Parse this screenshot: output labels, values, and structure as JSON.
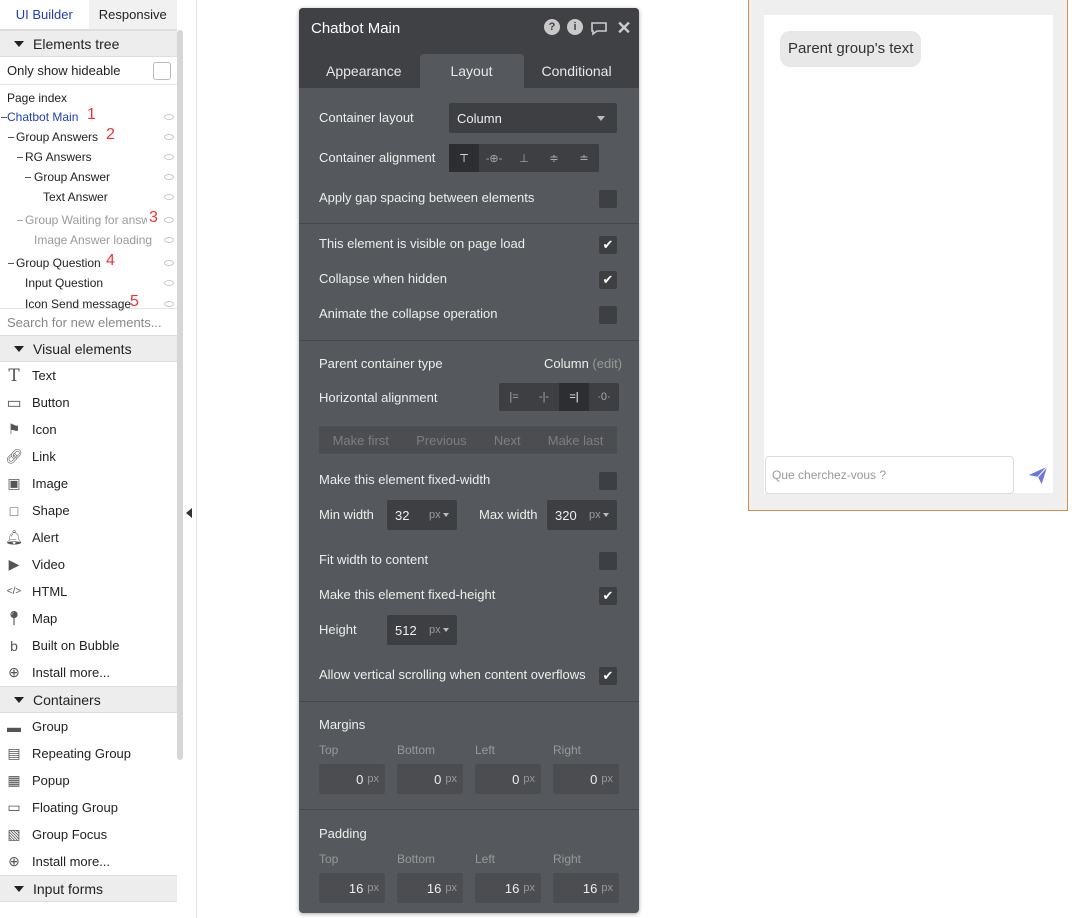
{
  "sidebar": {
    "tabs": [
      "UI Builder",
      "Responsive"
    ],
    "elements_tree_header": "Elements tree",
    "only_show_hideable": "Only show hideable",
    "page_index": "Page index",
    "tree": [
      {
        "label": "Chatbot Main",
        "num": "1"
      },
      {
        "label": "Group Answers",
        "num": "2"
      },
      {
        "label": "RG Answers"
      },
      {
        "label": "Group Answer"
      },
      {
        "label": "Text Answer"
      },
      {
        "label": "Group Waiting for answ",
        "num": "3"
      },
      {
        "label": "Image Answer loading"
      },
      {
        "label": "Group Question",
        "num": "4"
      },
      {
        "label": "Input Question"
      },
      {
        "label": "Icon Send message",
        "num": "5"
      }
    ],
    "search_placeholder": "Search for new elements...",
    "visual_header": "Visual elements",
    "visual_items": [
      {
        "label": "Text",
        "icon": "text-T-icon"
      },
      {
        "label": "Button",
        "icon": "button-click-icon"
      },
      {
        "label": "Icon",
        "icon": "flag-icon"
      },
      {
        "label": "Link",
        "icon": "link-icon"
      },
      {
        "label": "Image",
        "icon": "image-icon"
      },
      {
        "label": "Shape",
        "icon": "square-icon"
      },
      {
        "label": "Alert",
        "icon": "bell-icon"
      },
      {
        "label": "Video",
        "icon": "video-icon"
      },
      {
        "label": "HTML",
        "icon": "code-icon"
      },
      {
        "label": "Map",
        "icon": "map-pin-icon"
      },
      {
        "label": "Built on Bubble",
        "icon": "bubble-logo-icon"
      },
      {
        "label": "Install more...",
        "icon": "plus-circle-icon"
      }
    ],
    "containers_header": "Containers",
    "container_items": [
      {
        "label": "Group",
        "icon": "folder-icon"
      },
      {
        "label": "Repeating Group",
        "icon": "repeating-group-icon"
      },
      {
        "label": "Popup",
        "icon": "popup-icon"
      },
      {
        "label": "Floating Group",
        "icon": "floating-group-icon"
      },
      {
        "label": "Group Focus",
        "icon": "group-focus-icon"
      },
      {
        "label": "Install more...",
        "icon": "plus-circle-icon"
      }
    ],
    "input_forms_header": "Input forms"
  },
  "panel": {
    "title": "Chatbot Main",
    "tabs": [
      "Appearance",
      "Layout",
      "Conditional"
    ],
    "container_layout_label": "Container layout",
    "container_layout_value": "Column",
    "container_alignment_label": "Container alignment",
    "gap_label": "Apply gap spacing between elements",
    "visible_label": "This element is visible on page load",
    "collapse_label": "Collapse when hidden",
    "animate_label": "Animate the collapse operation",
    "parent_type_label": "Parent container type",
    "parent_type_value": "Column",
    "parent_type_edit": "(edit)",
    "horizontal_alignment_label": "Horizontal alignment",
    "order_buttons": [
      "Make first",
      "Previous",
      "Next",
      "Make last"
    ],
    "fixed_width_label": "Make this element fixed-width",
    "min_width_label": "Min width",
    "min_width_value": "32",
    "max_width_label": "Max width",
    "max_width_value": "320",
    "unit_px": "px",
    "fit_width_label": "Fit width to content",
    "fixed_height_label": "Make this element fixed-height",
    "height_label": "Height",
    "height_value": "512",
    "scroll_label": "Allow vertical scrolling when content overflows",
    "margins_label": "Margins",
    "padding_label": "Padding",
    "side_labels": [
      "Top",
      "Bottom",
      "Left",
      "Right"
    ],
    "margins": [
      "0",
      "0",
      "0",
      "0"
    ],
    "padding": [
      "16",
      "16",
      "16",
      "16"
    ],
    "checks": {
      "gap": false,
      "visible": true,
      "collapse": true,
      "animate": false,
      "fixed_width": false,
      "fit_width": false,
      "fixed_height": true,
      "scroll": true
    }
  },
  "preview": {
    "bubble_text": "Parent group's text",
    "input_placeholder": "Que cherchez-vous ?",
    "border_color": "#d98b4c",
    "send_icon_color": "#6b74e0"
  }
}
